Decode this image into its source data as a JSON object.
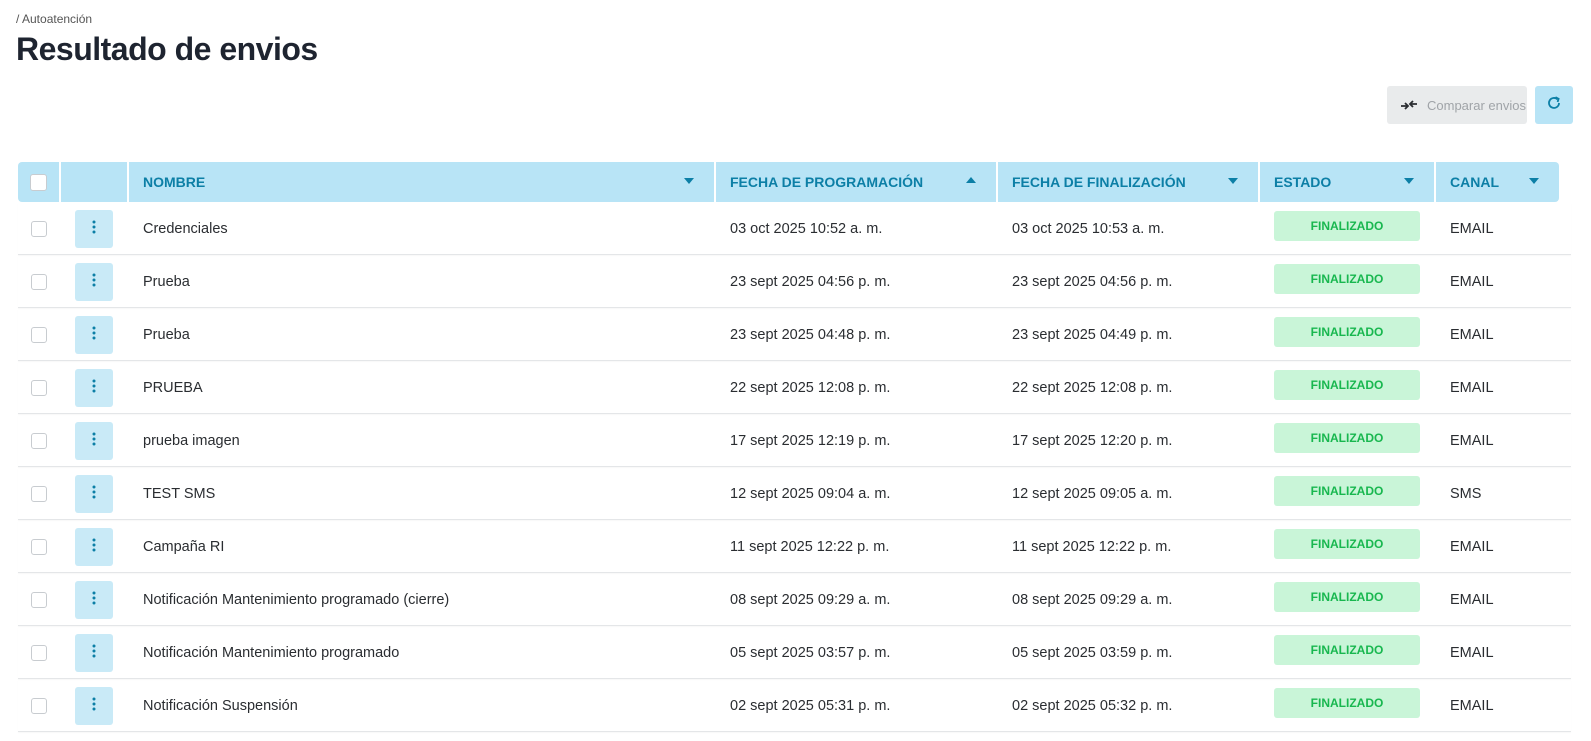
{
  "breadcrumb": "/ Autoatención",
  "page_title": "Resultado de envios",
  "toolbar": {
    "compare_label": "Comparar envios"
  },
  "table": {
    "columns": [
      "NOMBRE",
      "FECHA DE PROGRAMACIÓN",
      "FECHA DE FINALIZACIÓN",
      "ESTADO",
      "CANAL"
    ],
    "rows": [
      {
        "nombre": "Credenciales",
        "programacion": "03 oct 2025 10:52 a. m.",
        "finalizacion": "03 oct 2025 10:53 a. m.",
        "estado": "FINALIZADO",
        "canal": "EMAIL"
      },
      {
        "nombre": "Prueba",
        "programacion": "23 sept 2025 04:56 p. m.",
        "finalizacion": "23 sept 2025 04:56 p. m.",
        "estado": "FINALIZADO",
        "canal": "EMAIL"
      },
      {
        "nombre": "Prueba",
        "programacion": "23 sept 2025 04:48 p. m.",
        "finalizacion": "23 sept 2025 04:49 p. m.",
        "estado": "FINALIZADO",
        "canal": "EMAIL"
      },
      {
        "nombre": "PRUEBA",
        "programacion": "22 sept 2025 12:08 p. m.",
        "finalizacion": "22 sept 2025 12:08 p. m.",
        "estado": "FINALIZADO",
        "canal": "EMAIL"
      },
      {
        "nombre": "prueba imagen",
        "programacion": "17 sept 2025 12:19 p. m.",
        "finalizacion": "17 sept 2025 12:20 p. m.",
        "estado": "FINALIZADO",
        "canal": "EMAIL"
      },
      {
        "nombre": "TEST SMS",
        "programacion": "12 sept 2025 09:04 a. m.",
        "finalizacion": "12 sept 2025 09:05 a. m.",
        "estado": "FINALIZADO",
        "canal": "SMS"
      },
      {
        "nombre": "Campaña RI",
        "programacion": "11 sept 2025 12:22 p. m.",
        "finalizacion": "11 sept 2025 12:22 p. m.",
        "estado": "FINALIZADO",
        "canal": "EMAIL"
      },
      {
        "nombre": "Notificación Mantenimiento programado (cierre)",
        "programacion": "08 sept 2025 09:29 a. m.",
        "finalizacion": "08 sept 2025 09:29 a. m.",
        "estado": "FINALIZADO",
        "canal": "EMAIL"
      },
      {
        "nombre": "Notificación Mantenimiento programado",
        "programacion": "05 sept 2025 03:57 p. m.",
        "finalizacion": "05 sept 2025 03:59 p. m.",
        "estado": "FINALIZADO",
        "canal": "EMAIL"
      },
      {
        "nombre": "Notificación Suspensión",
        "programacion": "02 sept 2025 05:31 p. m.",
        "finalizacion": "02 sept 2025 05:32 p. m.",
        "estado": "FINALIZADO",
        "canal": "EMAIL"
      }
    ]
  },
  "icons": {
    "compare": "compare-arrows-icon",
    "refresh": "refresh-icon",
    "row_menu": "vertical-dots-icon",
    "sort_asc": "sort-up-icon",
    "sort_desc": "sort-down-icon"
  },
  "colors": {
    "header_bg": "#b8e4f6",
    "header_text": "#0c7fa6",
    "badge_bg": "#c9f5d8",
    "badge_text": "#18b74f"
  }
}
